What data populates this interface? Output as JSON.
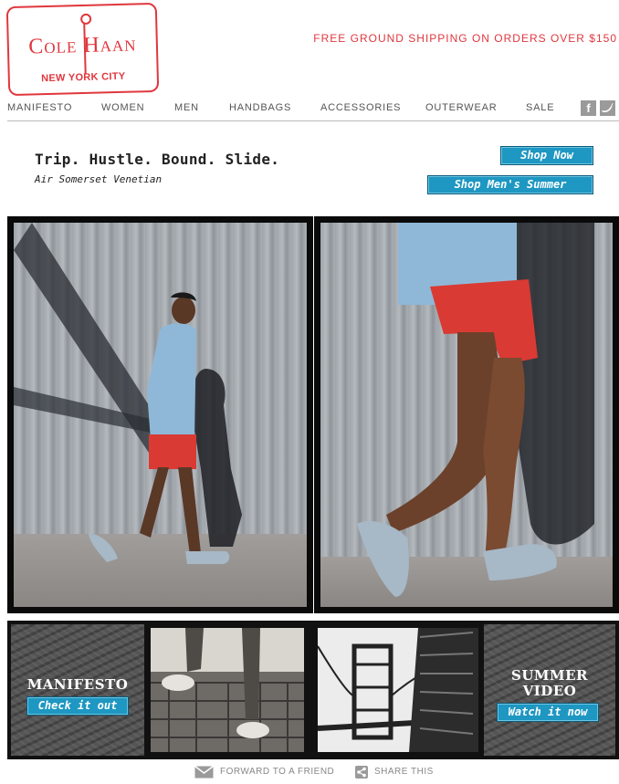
{
  "header": {
    "logo_brand": "Cole Haan",
    "logo_city": "NEW YORK CITY",
    "shipping_banner": "FREE GROUND SHIPPING ON ORDERS OVER $150"
  },
  "nav": {
    "items": [
      "MANIFESTO",
      "WOMEN",
      "MEN",
      "HANDBAGS",
      "ACCESSORIES",
      "OUTERWEAR",
      "SALE"
    ],
    "social": [
      "facebook-icon",
      "twitter-icon"
    ]
  },
  "promo": {
    "title": "Trip. Hustle. Bound. Slide.",
    "subtitle": "Air Somerset Venetian",
    "shop_now": "Shop Now",
    "shop_mens_summer": "Shop Men's Summer"
  },
  "features": {
    "manifesto_title": "MANIFESTO",
    "manifesto_cta": "Check it out",
    "video_title_1": "SUMMER",
    "video_title_2": "VIDEO",
    "video_cta": "Watch it now"
  },
  "footer": {
    "forward": "FORWARD TO A FRIEND",
    "share": "SHARE THIS"
  },
  "colors": {
    "brand_red": "#e0373e",
    "button_blue": "#1e97c2",
    "nav_text": "#555555"
  }
}
